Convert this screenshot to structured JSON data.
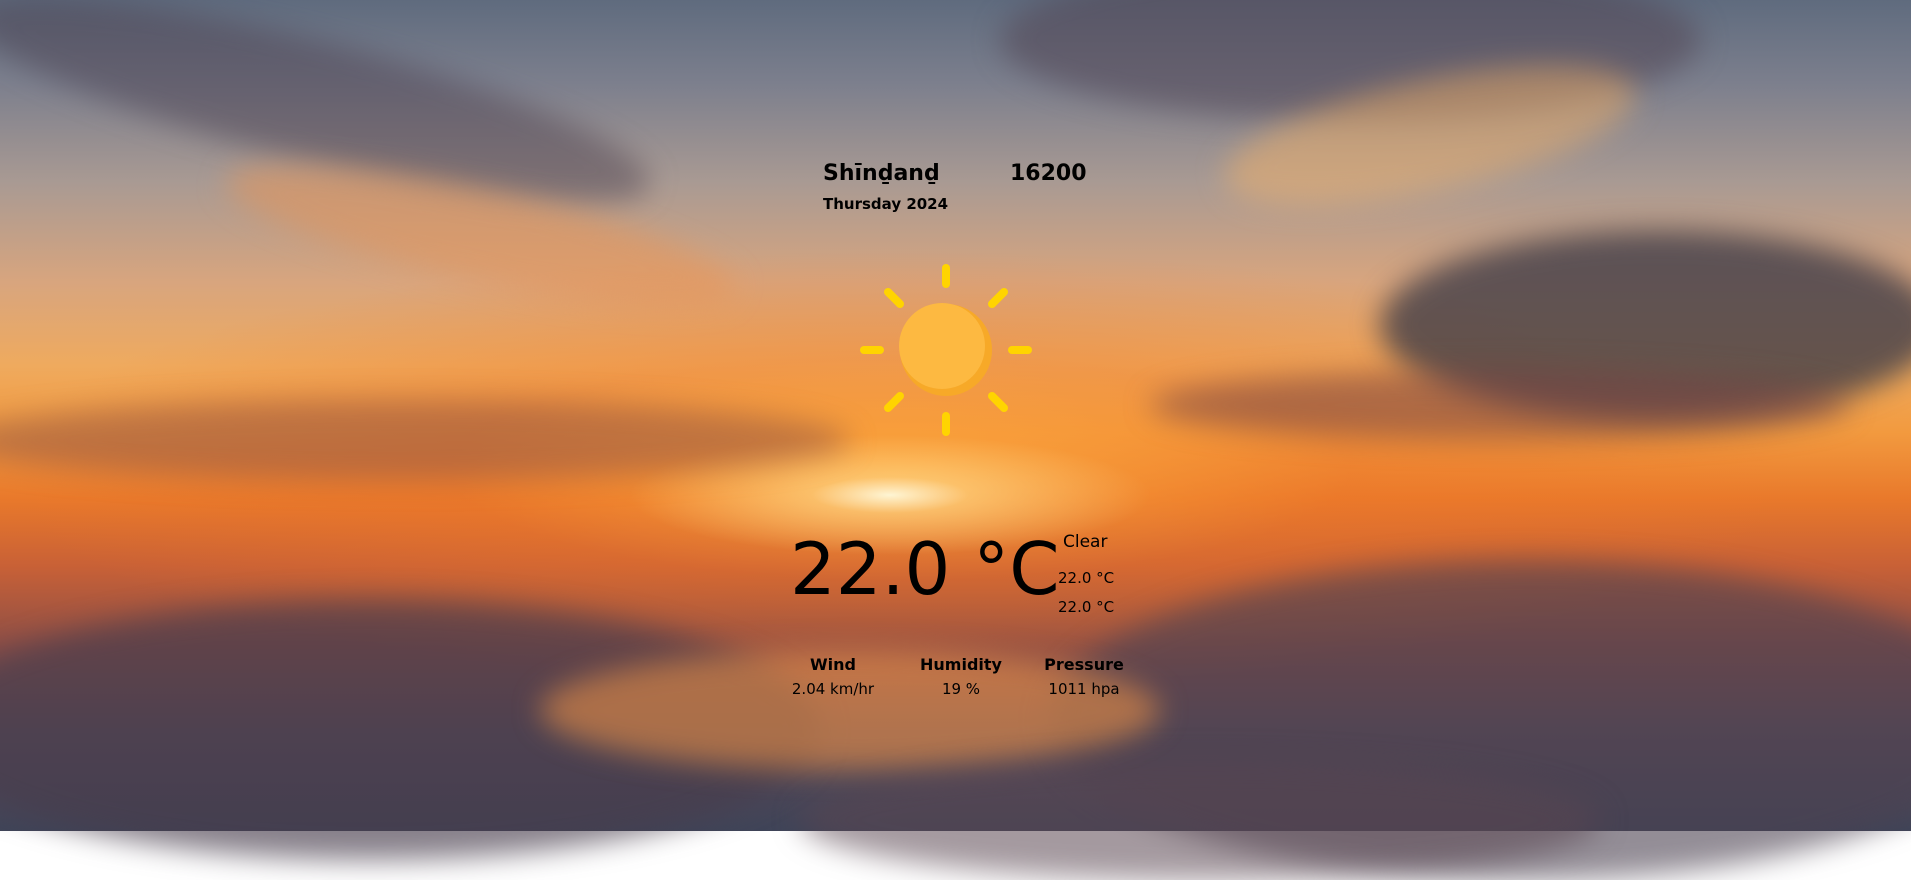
{
  "location": {
    "city": "Shīnḏanḏ",
    "postal_code": "16200",
    "date": "Thursday 2024"
  },
  "weather": {
    "icon": "sun-icon",
    "temperature": "22.0 °C",
    "condition": "Clear",
    "temp_max": "22.0 °C",
    "temp_min": "22.0 °C"
  },
  "stats": {
    "wind_label": "Wind",
    "wind_value": "2.04 km/hr",
    "humidity_label": "Humidity",
    "humidity_value": "19 %",
    "pressure_label": "Pressure",
    "pressure_value": "1011 hpa"
  },
  "colors": {
    "sun_body": "#fbb03b",
    "sun_rays": "#ffd400",
    "text": "#000000"
  }
}
